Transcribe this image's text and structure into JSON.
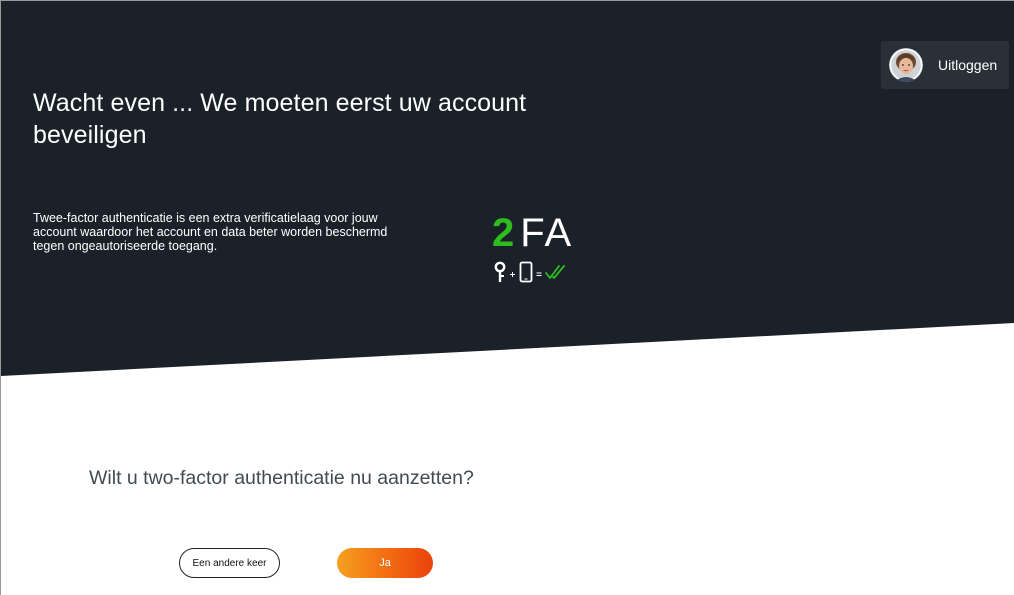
{
  "colors": {
    "hero_bg": "#1b2129",
    "accent_green": "#2ebd1f",
    "button_orange_start": "#f5a020",
    "button_orange_end": "#e9420c"
  },
  "header": {
    "title": "Wacht even ... We moeten eerst uw account beveiligen",
    "intro": "Twee-factor authenticatie is een extra verificatielaag voor jouw account waardoor het account en data beter worden beschermd tegen ongeautoriseerde toegang.",
    "logo": {
      "number": "2",
      "letters": "FA",
      "formula_icons": [
        "key-icon",
        "plus-sign",
        "phone-icon",
        "equals-sign",
        "double-check-icon"
      ]
    },
    "logout": {
      "label": "Uitloggen",
      "avatar_icon": "user-avatar"
    }
  },
  "main": {
    "question": "Wilt u two-factor authenticatie nu aanzetten?",
    "later_button": "Een andere keer",
    "yes_button": "Ja"
  }
}
